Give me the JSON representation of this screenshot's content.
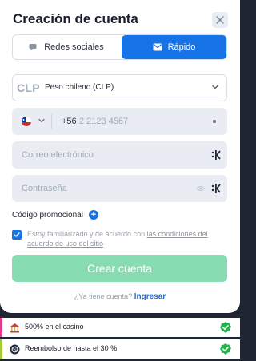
{
  "modal": {
    "title": "Creación de cuenta",
    "close_icon": "close-icon"
  },
  "tabs": {
    "social_label": "Redes sociales",
    "fast_label": "Rápido",
    "active": "fast"
  },
  "currency": {
    "code": "CLP",
    "name": "Peso chileno (CLP)"
  },
  "phone": {
    "country_flag": "chile-flag",
    "prefix": "+56",
    "placeholder": "2 2123 4567"
  },
  "email": {
    "placeholder": "Correo electrónico"
  },
  "password": {
    "placeholder": "Contraseña"
  },
  "promo": {
    "label": "Código promocional"
  },
  "terms": {
    "checked": true,
    "text": "Estoy familiarizado y de acuerdo con ",
    "link": "las condiciones del acuerdo de uso del sitio"
  },
  "create_button": {
    "label": "Crear cuenta"
  },
  "login": {
    "question": "¿Ya tiene cuenta? ",
    "link": "Ingresar"
  },
  "bonuses": [
    {
      "text": "500% en el casino",
      "accent": "#e33a8a"
    },
    {
      "text": "Reembolso de hasta el 30 %",
      "accent": "#a6c93a"
    }
  ],
  "colors": {
    "primary": "#1673e6",
    "create_button": "#88dcb1",
    "check_green": "#22b24c"
  }
}
